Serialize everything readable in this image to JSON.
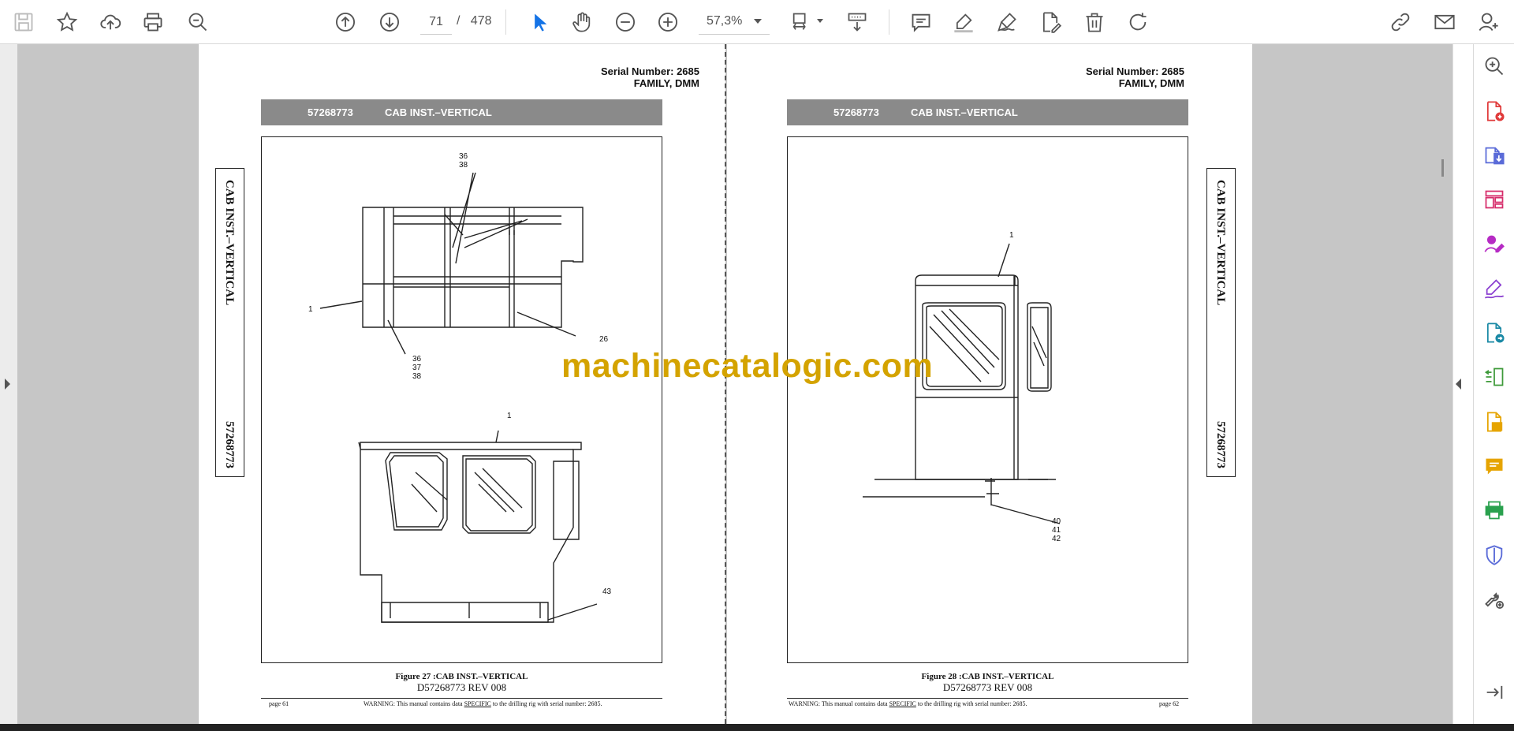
{
  "toolbar": {
    "page_current": "71",
    "page_sep": "/",
    "page_total": "478",
    "zoom": "57,3%"
  },
  "document": {
    "serial": "Serial Number: 2685",
    "family": "FAMILY, DMM",
    "part_number": "57268773",
    "section_title": "CAB INST.–VERTICAL",
    "side_label_title": "CAB INST.–VERTICAL",
    "side_label_number": "57268773",
    "left_page": {
      "figure_caption": "Figure 27 :CAB INST.–VERTICAL",
      "doc_rev": "D57268773 REV 008",
      "page_label": "page 61",
      "callouts": {
        "c1": "36\n38",
        "c2": "1",
        "c3": "26",
        "c4": "36\n37\n38",
        "c5": "1",
        "c6": "43"
      }
    },
    "right_page": {
      "figure_caption": "Figure 28 :CAB INST.–VERTICAL",
      "doc_rev": "D57268773 REV 008",
      "page_label": "page 62",
      "callouts": {
        "c1": "1",
        "c2": "40\n41\n42"
      }
    },
    "warning_pre": "WARNING:  This manual contains data ",
    "warning_specific": "SPECIFIC",
    "warning_post": " to the drilling rig with serial number: 2685."
  },
  "watermark": "machinecatalogic.com",
  "colors": {
    "accent_blue": "#1473e6",
    "banner_gray": "#8a8a8a",
    "watermark_gold": "#d4a300"
  },
  "icons": {
    "toolbar": [
      "save-icon",
      "star-icon",
      "upload-icon",
      "print-icon",
      "zoom-search-icon",
      "prev-page-icon",
      "next-page-icon",
      "select-arrow-icon",
      "hand-icon",
      "zoom-out-icon",
      "zoom-in-icon",
      "fit-page-icon",
      "scroll-mode-icon",
      "comment-icon",
      "highlight-icon",
      "draw-icon",
      "edit-pdf-icon",
      "delete-icon",
      "rotate-icon",
      "share-link-icon",
      "email-icon",
      "add-user-icon"
    ],
    "right_panel": [
      "search-zoom-icon",
      "create-pdf-icon",
      "export-pdf-icon",
      "organize-pages-icon",
      "request-signature-icon",
      "fill-sign-icon",
      "convert-pdf-icon",
      "compare-icon",
      "edit-text-icon",
      "comment-panel-icon",
      "print-production-icon",
      "protect-icon",
      "more-tools-icon",
      "collapse-panel-icon"
    ]
  }
}
